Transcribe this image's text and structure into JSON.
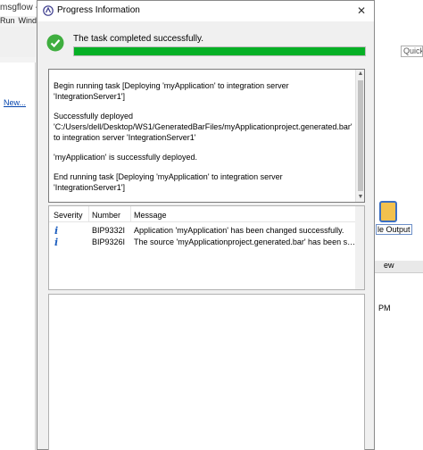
{
  "background": {
    "window_title_fragment": "msgflow -",
    "menu": [
      "Run",
      "Wind"
    ],
    "nav_link": "New...",
    "quick_access": "Quick",
    "output_button_label": "le Output",
    "view_tab": "ew",
    "time_fragment": "PM"
  },
  "dialog": {
    "title": "Progress Information",
    "close_icon": "close-icon",
    "status": {
      "icon": "check-icon",
      "text": "The task completed successfully.",
      "progress": 1.0,
      "progress_color": "#06b025"
    },
    "log": [
      "Begin running task [Deploying 'myApplication' to integration server 'IntegrationServer1']",
      "",
      "Successfully deployed 'C:/Users/dell/Desktop/WS1/GeneratedBarFiles/myApplicationproject.generated.bar' to integration server 'IntegrationServer1'",
      "",
      "'myApplication' is successfully deployed.",
      "",
      "End running task [Deploying 'myApplication' to integration server 'IntegrationServer1']"
    ],
    "messages": {
      "columns": [
        "Severity",
        "Number",
        "Message"
      ],
      "rows": [
        {
          "severity_icon": "info-icon",
          "number": "BIP9332I",
          "message": "Application 'myApplication' has been changed successfully."
        },
        {
          "severity_icon": "info-icon",
          "number": "BIP9326I",
          "message": "The source 'myApplicationproject.generated.bar' has been su..."
        }
      ]
    }
  }
}
